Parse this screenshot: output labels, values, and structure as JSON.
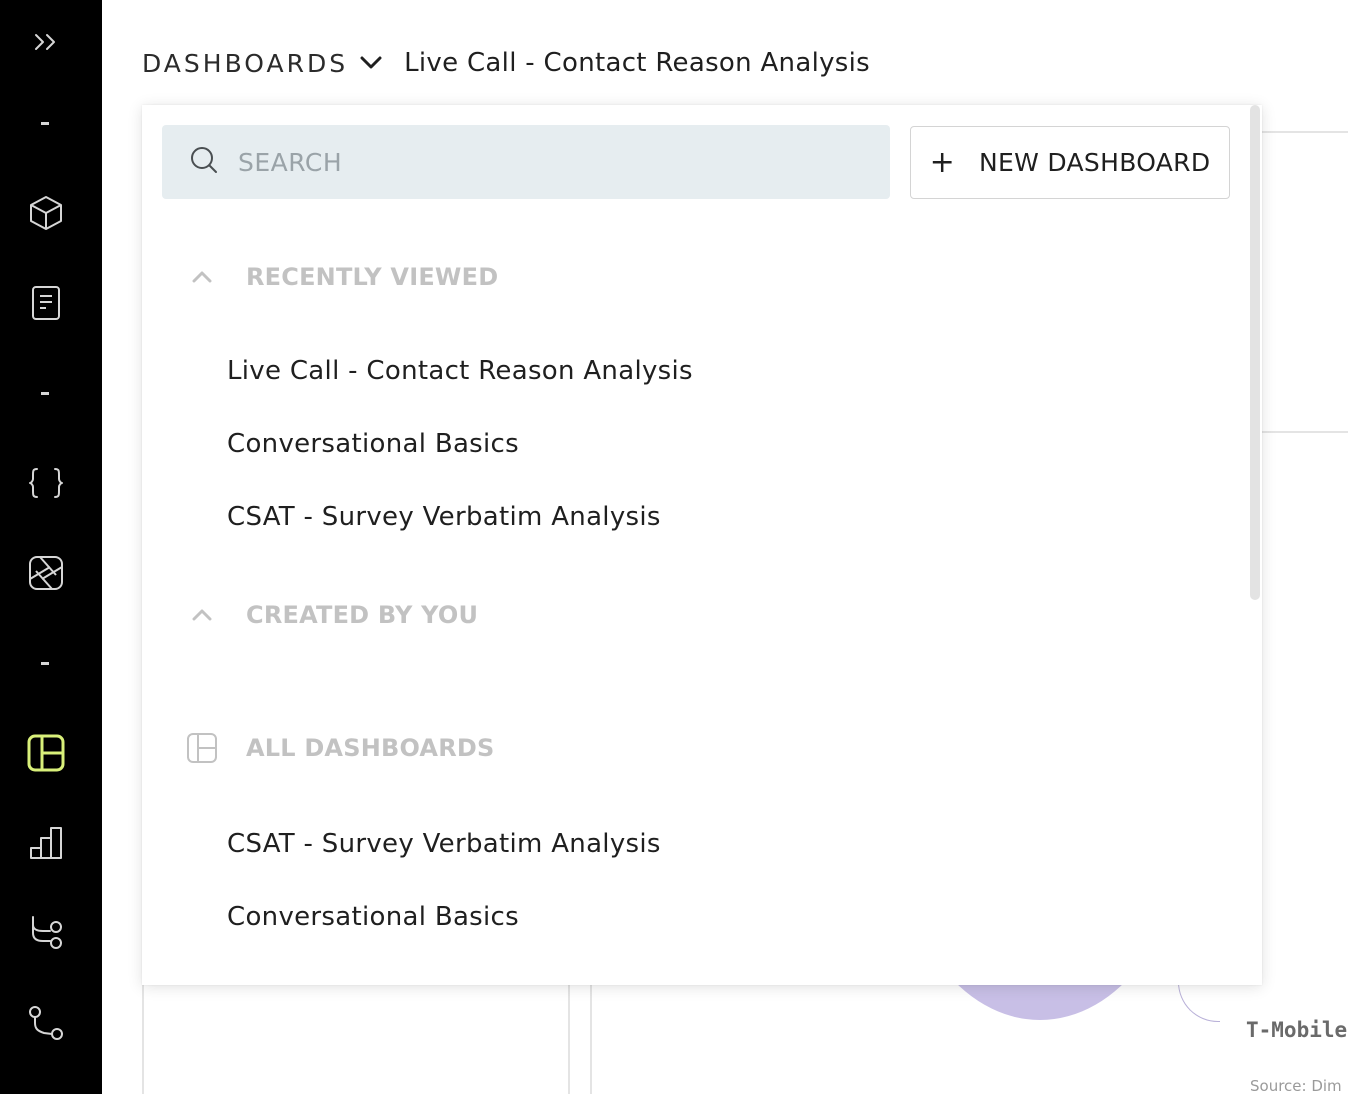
{
  "rail": {
    "items": [
      {
        "icon": "expand-icon"
      },
      {
        "icon": "cube-icon"
      },
      {
        "icon": "document-icon"
      },
      {
        "icon": "code-braces-icon"
      },
      {
        "icon": "aperture-icon"
      },
      {
        "icon": "dashboard-icon",
        "active": true
      },
      {
        "icon": "bar-chart-icon"
      },
      {
        "icon": "branch-icon"
      },
      {
        "icon": "route-icon"
      }
    ],
    "active_color": "#d9f07a"
  },
  "header": {
    "dashboards_label": "DASHBOARDS",
    "current_dashboard": "Live Call - Contact Reason Analysis"
  },
  "dropdown": {
    "search_placeholder": "SEARCH",
    "new_button_label": "NEW DASHBOARD",
    "sections": {
      "recent": {
        "title": "RECENTLY VIEWED",
        "items": [
          "Live Call - Contact Reason Analysis",
          "Conversational Basics",
          "CSAT - Survey Verbatim Analysis"
        ]
      },
      "created": {
        "title": "CREATED BY YOU",
        "items": []
      },
      "all": {
        "title": "ALL DASHBOARDS",
        "items": [
          "CSAT - Survey Verbatim Analysis",
          "Conversational Basics"
        ]
      }
    }
  },
  "background": {
    "chart_label": "T-Mobile",
    "source_text": "Source: Dim"
  }
}
